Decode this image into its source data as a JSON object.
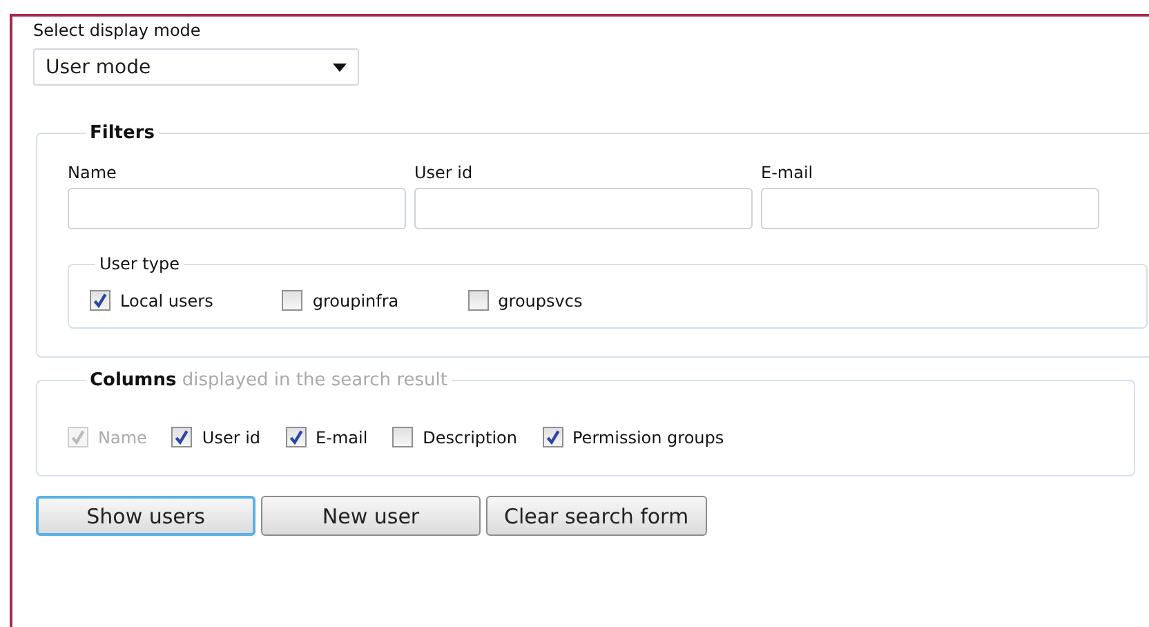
{
  "display_mode": {
    "label": "Select display mode",
    "value": "User mode"
  },
  "filters": {
    "legend": "Filters",
    "fields": [
      {
        "label": "Name"
      },
      {
        "label": "User id"
      },
      {
        "label": "E-mail"
      }
    ],
    "user_type": {
      "legend": "User type",
      "options": [
        {
          "label": "Local users",
          "checked": true
        },
        {
          "label": "groupinfra",
          "checked": false
        },
        {
          "label": "groupsvcs",
          "checked": false
        }
      ]
    }
  },
  "columns": {
    "legend": "**Columns** displayed in the search result",
    "options": [
      {
        "label": "Name",
        "checked": true,
        "disabled": true
      },
      {
        "label": "User id",
        "checked": true,
        "disabled": false
      },
      {
        "label": "E-mail",
        "checked": true,
        "disabled": false
      },
      {
        "label": "Description",
        "checked": false,
        "disabled": false
      },
      {
        "label": "Permission groups",
        "checked": true,
        "disabled": false
      }
    ]
  },
  "buttons": [
    {
      "label": "Show users",
      "focused": true
    },
    {
      "label": "New user",
      "focused": false
    },
    {
      "label": "Clear search form",
      "focused": false
    }
  ]
}
